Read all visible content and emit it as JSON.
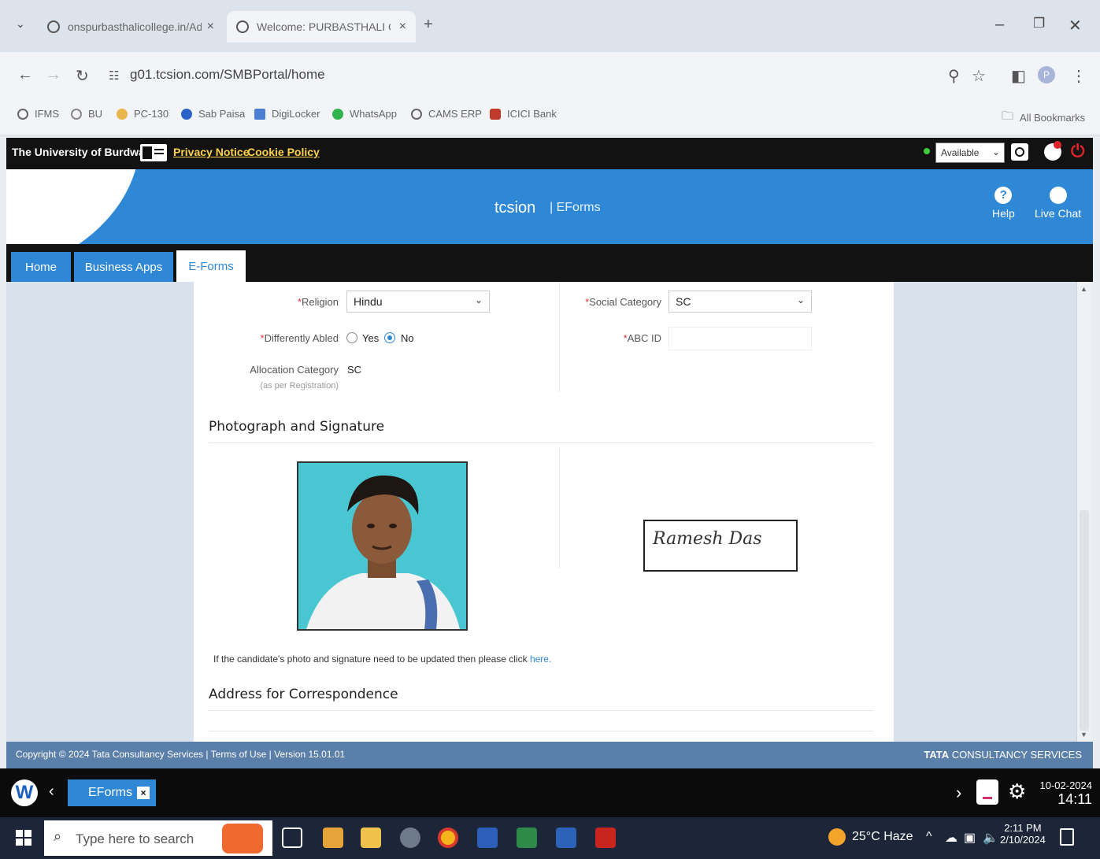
{
  "browser": {
    "tabs": [
      {
        "title": "onspurbasthalicollege.in/Admi"
      },
      {
        "title": "Welcome: PURBASTHALI COL"
      }
    ],
    "new_tab_label": "+",
    "url": "g01.tcsion.com/SMBPortal/home",
    "bookmarks": [
      "IFMS",
      "BU",
      "PC-130",
      "Sab Paisa",
      "DigiLocker",
      "WhatsApp",
      "CAMS ERP",
      "ICICI Bank"
    ],
    "all_bookmarks_label": "All Bookmarks",
    "profile_initial": "P"
  },
  "site": {
    "university": "The University of Burdwan.",
    "privacy_link": "Privacy Notice",
    "cookie_link": "Cookie Policy",
    "status": "Available",
    "brand_logo": "tcsion",
    "brand_sub": "| EForms",
    "help_label": "Help",
    "chat_label": "Live Chat",
    "tabs": [
      "Home",
      "Business Apps",
      "E-Forms"
    ],
    "active_tab": "E-Forms"
  },
  "form": {
    "religion_label": "Religion",
    "religion_value": "Hindu",
    "social_category_label": "Social Category",
    "social_category_value": "SC",
    "differently_abled_label": "Differently Abled",
    "yes_label": "Yes",
    "no_label": "No",
    "abc_id_label": "ABC ID",
    "abc_id_value": "",
    "allocation_label": "Allocation Category",
    "allocation_sub": "(as per Registration)",
    "allocation_value": "SC",
    "photo_section_title": "Photograph and Signature",
    "signature_text": "Ramesh  Das",
    "update_note": "If the candidate's photo and signature need to be updated then please click",
    "update_link": "here.",
    "address_section_title": "Address for Correspondence"
  },
  "footer": {
    "copyright": "Copyright © 2024 Tata Consultancy Services | Terms of Use | Version 15.01.01",
    "brand_bold": "TATA",
    "brand_rest": "CONSULTANCY SERVICES"
  },
  "appbar": {
    "task_label": "EForms",
    "date": "10-02-2024",
    "time": "14:11"
  },
  "taskbar": {
    "search_placeholder": "Type here to search",
    "weather": "25°C  Haze",
    "clock_time": "2:11 PM",
    "clock_date": "2/10/2024"
  },
  "colors": {
    "accent_blue": "#2e88d6",
    "link_yellow": "#ffd24d",
    "footer_blue": "#5a7fa8"
  }
}
